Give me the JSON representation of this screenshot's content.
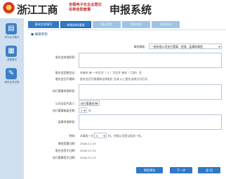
{
  "header": {
    "brand": "浙江工商",
    "brand_sub_line1": "全程电子化企业登记",
    "brand_sub_line2": "名称自助查重",
    "title": "申报系统"
  },
  "sidebar": {
    "items": [
      {
        "label": "开办企业登记",
        "icon": "document-icon"
      },
      {
        "label": "变更登记",
        "icon": "form-icon"
      },
      {
        "label": "我的业务记录",
        "icon": "wrench-icon"
      }
    ]
  },
  "steps": [
    {
      "label": "基本信息填写",
      "state": "done"
    },
    {
      "label": "申报材料填报",
      "state": "active"
    },
    {
      "label": "确认提交",
      "state": "pending"
    },
    {
      "label": "等待审核",
      "state": "pending"
    },
    {
      "label": "办理完成",
      "state": "pending"
    }
  ],
  "form": {
    "section_title": "● 编辑章程",
    "template_label": "章程模板：",
    "template_value": "一般有限公司执行董事、经理、监事和章程",
    "shareholder_decision_label": "股东会其他职权：",
    "shareholder_meeting_label": "股东会定期会议：",
    "shareholder_meeting_text": "在每年 每 一年召开（ 2 ）月召开 每年（ 月份）召",
    "notice_label": "股东会召开通知：",
    "notice_text": "股东会召开前通知全体股东 全体 以上股东出席方可召开。",
    "exec_director_other_label": "执行董事其他职权：",
    "legal_rep_label": "公司法定代表人：",
    "legal_rep_value": "执行董事担任",
    "exec_director_term_label": "执行董事每届任期：",
    "exec_director_term_value": "3",
    "exec_director_term_unit": "年",
    "supervisor_other_label": "监事其他职权：",
    "copies_label": "附则：",
    "copies_prefix": "本章程一式",
    "copies_value": "5",
    "copies_suffix": "份，并报公司登记机关一份。",
    "sign_date_label": "章程签署日期：",
    "sign_date_value": "2016-11-15",
    "shareholder_sign_label": "股东会签字日期：",
    "shareholder_sign_value": "2016-11-15",
    "director_sign_label": "执行董事签字日期：",
    "director_sign_value": "2016-11-15"
  },
  "buttons": {
    "preview": "章程预览",
    "next": "下一步",
    "back": "返 回"
  }
}
